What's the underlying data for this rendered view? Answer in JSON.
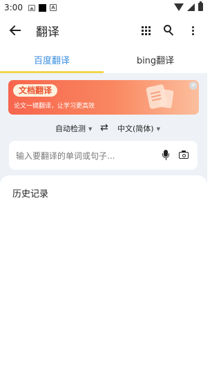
{
  "status_bar": {
    "time": "3:00"
  },
  "app_bar": {
    "title": "翻译"
  },
  "tabs": [
    {
      "label": "百度翻译",
      "active": true
    },
    {
      "label": "bing翻译",
      "active": false
    }
  ],
  "banner": {
    "badge": "文档翻译",
    "subtitle": "论文一键翻译，让学习更高效",
    "close": "×"
  },
  "language": {
    "from": "自动检测",
    "to": "中文(简体)",
    "swap": "⇄"
  },
  "input": {
    "placeholder": "输入要翻译的单词或句子..."
  },
  "history": {
    "title": "历史记录"
  },
  "colors": {
    "accent": "#3b8de0",
    "tab_indicator": "#f2d44d",
    "banner_start": "#f7654d",
    "background": "#eef1f6"
  }
}
